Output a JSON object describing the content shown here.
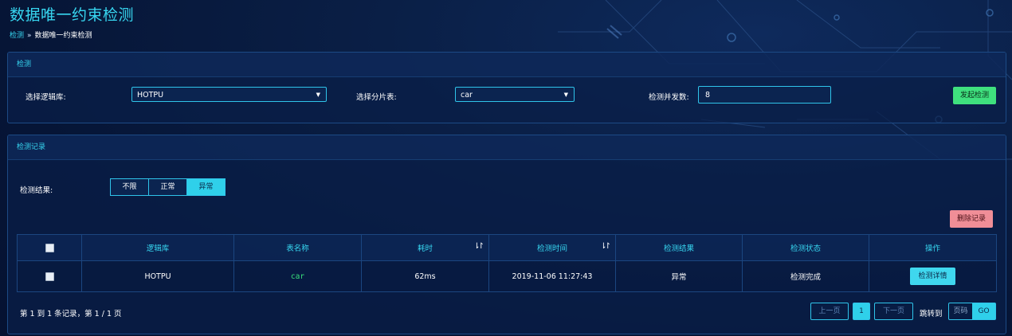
{
  "page": {
    "title": "数据唯一约束检测"
  },
  "breadcrumb": {
    "link": "检测",
    "separator": "»",
    "current": "数据唯一约束检测"
  },
  "detect_panel": {
    "title": "检测",
    "db_label": "选择逻辑库:",
    "db_value": "HOTPU",
    "table_label": "选择分片表:",
    "table_value": "car",
    "concurrency_label": "检测并发数:",
    "concurrency_value": "8",
    "start_button": "发起检测"
  },
  "records_panel": {
    "title": "检测记录",
    "filter_label": "检测结果:",
    "filter_options": [
      "不限",
      "正常",
      "异常"
    ],
    "filter_selected": "异常",
    "delete_button": "删除记录",
    "columns": [
      "逻辑库",
      "表名称",
      "耗时",
      "检测时间",
      "检测结果",
      "检测状态",
      "操作"
    ],
    "rows": [
      {
        "db": "HOTPU",
        "table": "car",
        "duration": "62ms",
        "time": "2019-11-06 11:27:43",
        "result": "异常",
        "status": "检测完成",
        "action": "检测详情"
      }
    ],
    "pagination": {
      "info": "第 1 到 1 条记录，第 1 / 1 页",
      "prev": "上一页",
      "current": "1",
      "next": "下一页",
      "jump_label": "跳转到",
      "jump_placeholder": "页码",
      "go": "GO"
    }
  },
  "colors": {
    "accent": "#37d6f0",
    "start": "#3fe07e",
    "delete": "#f08e97",
    "background": "#0a1f46"
  }
}
